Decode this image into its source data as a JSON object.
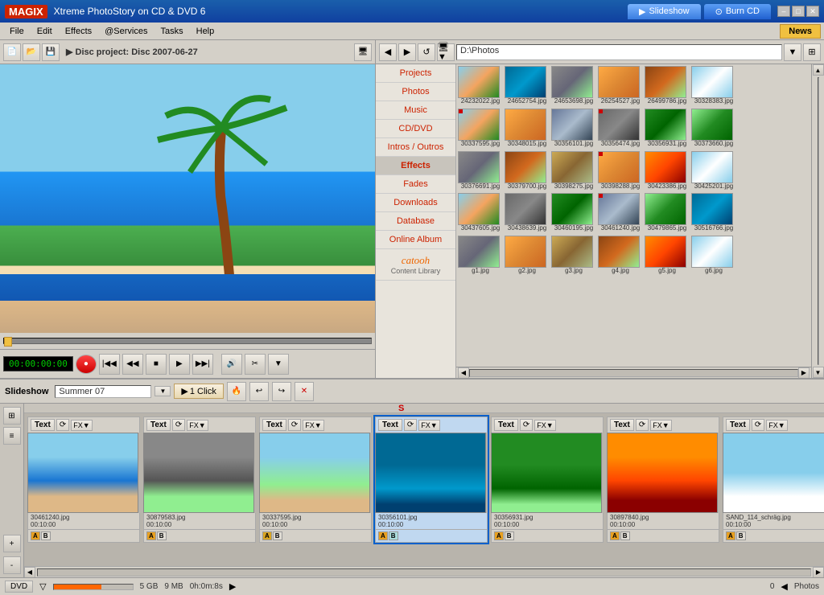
{
  "titlebar": {
    "logo": "MAGIX",
    "title": "Xtreme PhotoStory on CD & DVD 6",
    "tab_slideshow": "Slideshow",
    "tab_burncd": "Burn CD",
    "win_minimize": "–",
    "win_maximize": "□",
    "win_close": "✕"
  },
  "menubar": {
    "items": [
      "File",
      "Edit",
      "Effects",
      "@Services",
      "Tasks",
      "Help"
    ],
    "news": "News"
  },
  "toolbar": {
    "disc_label": "▶  Disc project: Disc 2007-06-27",
    "icons": [
      "new",
      "open",
      "save",
      "monitor"
    ]
  },
  "preview": {
    "time": "00:00:00:00"
  },
  "browser": {
    "path": "D:\\Photos",
    "categories": [
      "Projects",
      "Photos",
      "Music",
      "CD/DVD",
      "Intros / Outros",
      "Effects",
      "Fades",
      "Downloads",
      "Database",
      "Online Album"
    ],
    "catooh_label": "catooh",
    "catooh_sub": "Content Library",
    "photos": [
      {
        "name": "24232022.jpg"
      },
      {
        "name": "24652754.jpg"
      },
      {
        "name": "24653698.jpg"
      },
      {
        "name": "26254527.jpg"
      },
      {
        "name": "26499786.jpg"
      },
      {
        "name": "30328383.jpg"
      },
      {
        "name": "30337595.jpg",
        "red": true
      },
      {
        "name": "30348015.jpg"
      },
      {
        "name": "30356101.jpg"
      },
      {
        "name": "30356474.jpg",
        "red": true
      },
      {
        "name": "30356931.jpg"
      },
      {
        "name": "30373660.jpg"
      },
      {
        "name": "30376691.jpg"
      },
      {
        "name": "30379700.jpg"
      },
      {
        "name": "30398275.jpg"
      },
      {
        "name": "30398288.jpg",
        "red": true
      },
      {
        "name": "30423386.jpg"
      },
      {
        "name": "30425201.jpg"
      },
      {
        "name": "30437605.jpg"
      },
      {
        "name": "30438639.jpg"
      },
      {
        "name": "30460195.jpg"
      },
      {
        "name": "30461240.jpg",
        "red": true
      },
      {
        "name": "30479865.jpg"
      },
      {
        "name": "30516766.jpg"
      },
      {
        "name": "g1.jpg"
      },
      {
        "name": "g2.jpg"
      },
      {
        "name": "g3.jpg"
      },
      {
        "name": "g4.jpg"
      },
      {
        "name": "g5.jpg"
      },
      {
        "name": "g6.jpg"
      }
    ]
  },
  "slideshow_bar": {
    "label": "Slideshow",
    "name": "Summer 07",
    "one_click": "1 Click",
    "actions": [
      "play",
      "back",
      "forward",
      "delete"
    ]
  },
  "timeline": {
    "slides": [
      {
        "name": "30461240.jpg",
        "time": "00:10:00",
        "text": "Text",
        "active": false,
        "color": "beach1"
      },
      {
        "name": "30879583.jpg",
        "time": "00:10:00",
        "text": "Text",
        "active": false,
        "color": "couple"
      },
      {
        "name": "30337595.jpg",
        "time": "00:10:00",
        "text": "Text",
        "active": false,
        "color": "group"
      },
      {
        "name": "30356101.jpg",
        "time": "00:10:00",
        "text": "Text",
        "active": true,
        "color": "underwater"
      },
      {
        "name": "30356931.jpg",
        "time": "00:10:00",
        "text": "Text",
        "active": false,
        "color": "forest"
      },
      {
        "name": "30897840.jpg",
        "time": "00:10:00",
        "text": "Text",
        "active": false,
        "color": "sunset"
      },
      {
        "name": "SAND_114_schräg.jpg",
        "time": "00:10:00",
        "text": "Text",
        "active": false,
        "color": "sky"
      }
    ]
  },
  "statusbar": {
    "format": "DVD",
    "size1": "5 GB",
    "size2": "9 MB",
    "duration": "0h:0m:8s",
    "count": "0",
    "photos_label": "Photos"
  }
}
